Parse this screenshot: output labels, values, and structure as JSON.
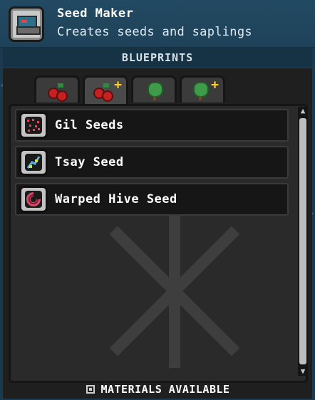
{
  "header": {
    "title": "Seed Maker",
    "subtitle": "Creates seeds and saplings",
    "icon": "seed-maker-machine-icon"
  },
  "section": {
    "label": "BLUEPRINTS"
  },
  "tabs": [
    {
      "icon": "berries-icon",
      "plus": ""
    },
    {
      "icon": "berries-plus-icon",
      "plus": "+"
    },
    {
      "icon": "tree-icon",
      "plus": ""
    },
    {
      "icon": "tree-plus-icon",
      "plus": "+"
    }
  ],
  "recipes": [
    {
      "label": "Gil Seeds",
      "icon": "gil-seeds-icon",
      "color": "#e4415a"
    },
    {
      "label": "Tsay Seed",
      "icon": "tsay-seed-icon",
      "color": "#5fb0e0"
    },
    {
      "label": "Warped Hive Seed",
      "icon": "warped-hive-seed-icon",
      "color": "#d44a6a"
    }
  ],
  "footer": {
    "label": "MATERIALS AVAILABLE"
  }
}
